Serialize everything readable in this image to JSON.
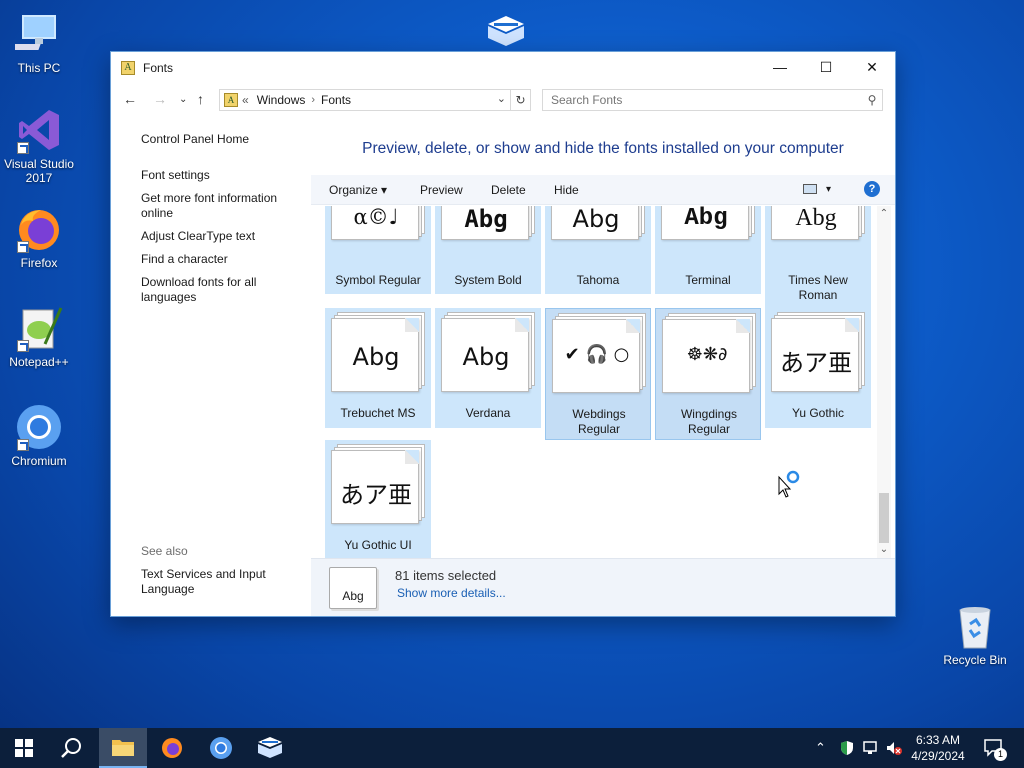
{
  "desktop": {
    "icons": [
      {
        "label": "This PC"
      },
      {
        "label": "Visual Studio 2017"
      },
      {
        "label": "Firefox"
      },
      {
        "label": "Notepad++"
      },
      {
        "label": "Chromium"
      }
    ],
    "recycle_bin": "Recycle Bin"
  },
  "window": {
    "title": "Fonts",
    "controls": {
      "minimize": "—",
      "maximize": "☐",
      "close": "✕"
    },
    "address": {
      "prefix": "«",
      "crumbs": [
        "Windows",
        "Fonts"
      ]
    },
    "search": {
      "placeholder": "Search Fonts"
    },
    "left_pane": {
      "links": [
        "Control Panel Home",
        "Font settings",
        "Get more font information online",
        "Adjust ClearType text",
        "Find a character",
        "Download fonts for all languages"
      ],
      "see_also_header": "See also",
      "see_also_links": [
        "Text Services and Input Language"
      ]
    },
    "heading": "Preview, delete, or show and hide the fonts installed on your computer",
    "toolbar": {
      "organize": "Organize ▾",
      "preview": "Preview",
      "delete": "Delete",
      "hide": "Hide",
      "view_dropdown": "▾",
      "help": "?"
    },
    "fonts": [
      {
        "name": "Symbol Regular",
        "sample": "α©♩"
      },
      {
        "name": "System Bold",
        "sample": "Abg"
      },
      {
        "name": "Tahoma",
        "sample": "Abg"
      },
      {
        "name": "Terminal",
        "sample": "Abg"
      },
      {
        "name": "Times New Roman",
        "sample": "Abg"
      },
      {
        "name": "Trebuchet MS",
        "sample": "Abg"
      },
      {
        "name": "Verdana",
        "sample": "Abg"
      },
      {
        "name": "Webdings Regular",
        "sample": "✔ 🎧 ○"
      },
      {
        "name": "Wingdings Regular",
        "sample": "☸❋∂"
      },
      {
        "name": "Yu Gothic",
        "sample": "あア亜"
      },
      {
        "name": "Yu Gothic UI",
        "sample": "あア亜"
      }
    ],
    "details": {
      "thumb_label": "Abg",
      "count": "81 items selected",
      "more": "Show more details..."
    }
  },
  "taskbar": {
    "clock_time": "6:33 AM",
    "clock_date": "4/29/2024",
    "notification_count": "1"
  }
}
